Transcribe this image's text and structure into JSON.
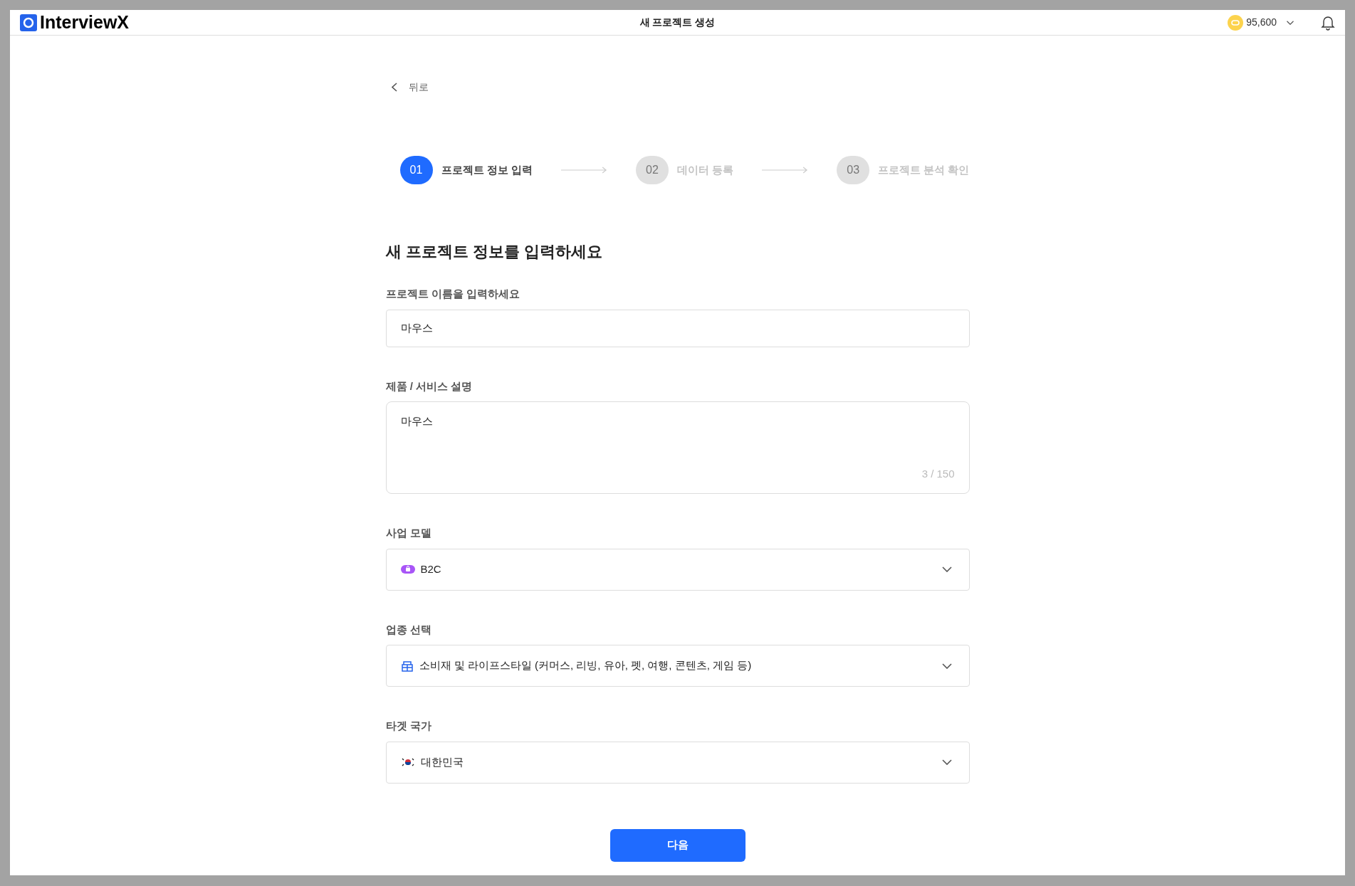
{
  "header": {
    "logo": "InterviewX",
    "title": "새 프로젝트 생성",
    "credits": "95,600"
  },
  "back": "뒤로",
  "steps": [
    {
      "number": "01",
      "label": "프로젝트 정보 입력",
      "selected": true
    },
    {
      "number": "02",
      "label": "데이터 등록",
      "selected": false
    },
    {
      "number": "03",
      "label": "프로젝트 분석 확인",
      "selected": false
    }
  ],
  "heading": "새 프로젝트 정보를 입력하세요",
  "fields": [
    {
      "kind": "input",
      "label": "프로젝트 이름을 입력하세요",
      "value": "마우스"
    },
    {
      "kind": "textarea",
      "label": "제품 / 서비스 설명",
      "value": "마우스",
      "counter": "3 / 150"
    },
    {
      "kind": "select",
      "label": "사업 모델",
      "value": "B2C"
    },
    {
      "kind": "select",
      "label": "업종 선택",
      "value": "소비재 및 라이프스타일 (커머스, 리빙, 유아, 펫, 여행, 콘텐츠, 게임 등)"
    },
    {
      "kind": "select",
      "label": "타겟 국가",
      "value": "대한민국"
    }
  ],
  "next_button": "다음"
}
